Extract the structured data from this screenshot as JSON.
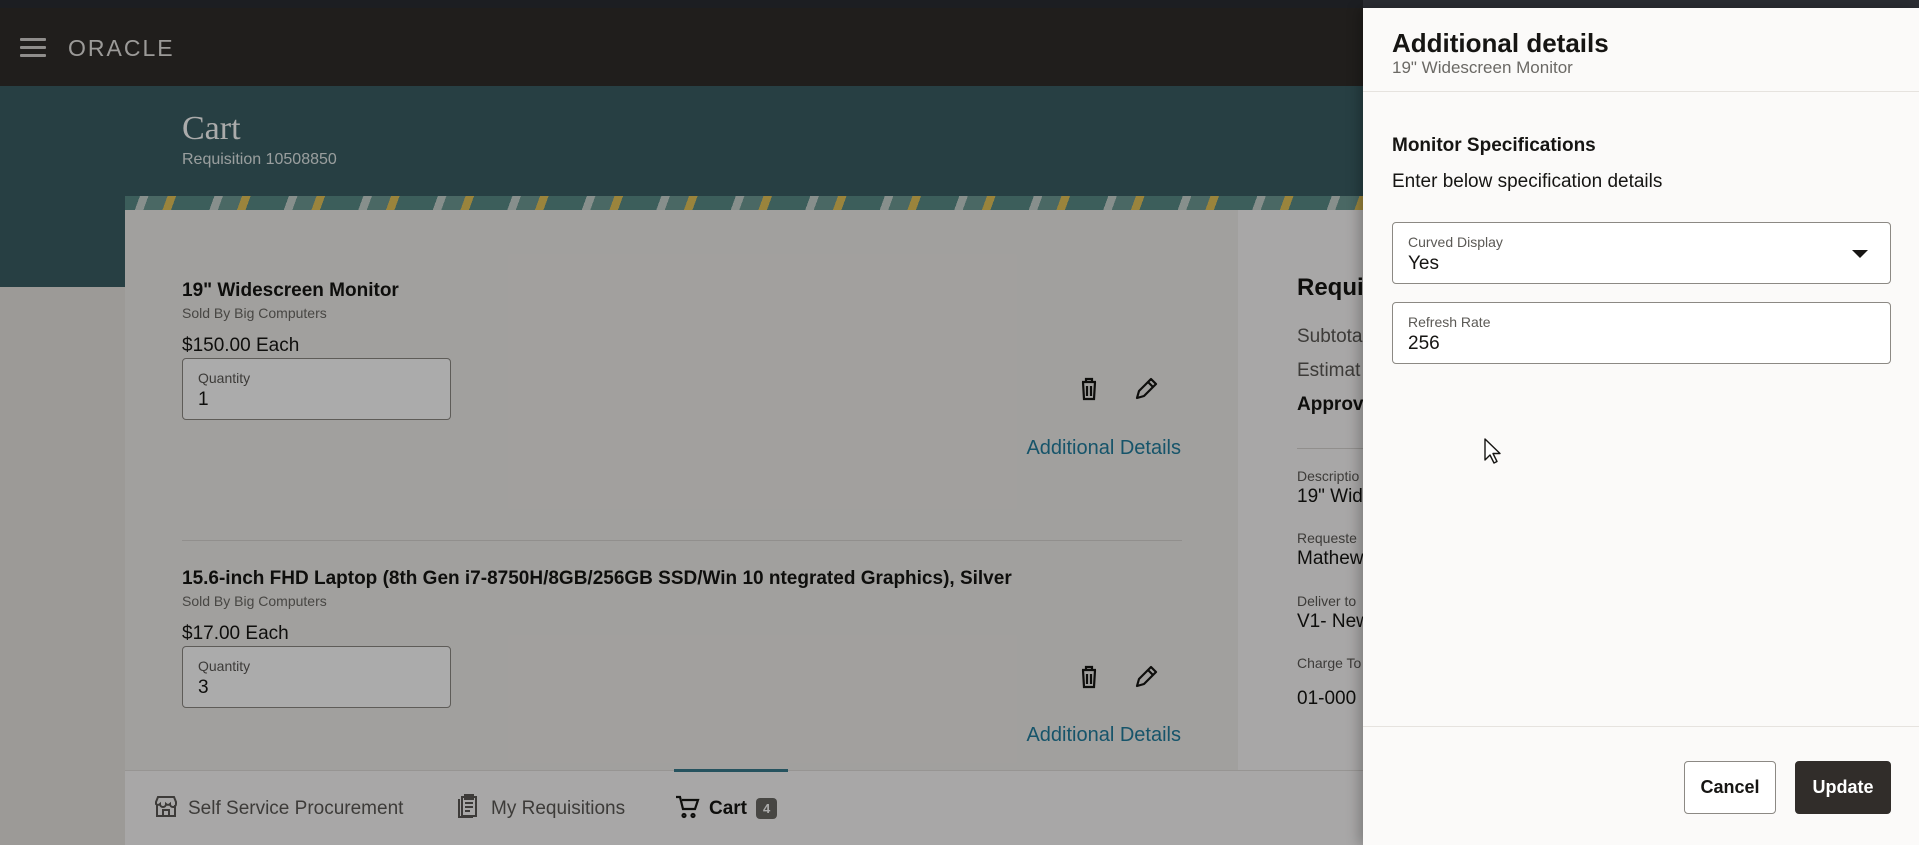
{
  "header": {
    "logo": "ORACLE"
  },
  "banner": {
    "title": "Cart",
    "subtitle": "Requisition 10508850"
  },
  "cart": {
    "items": [
      {
        "title": "19\" Widescreen Monitor",
        "seller": "Sold By Big Computers",
        "price": "$150.00 Each",
        "quantity_label": "Quantity",
        "quantity": "1",
        "details_link": "Additional Details"
      },
      {
        "title": "15.6-inch FHD Laptop (8th Gen i7-8750H/8GB/256GB SSD/Win 10 ntegrated Graphics), Silver",
        "seller": "Sold By Big Computers",
        "price": "$17.00 Each",
        "quantity_label": "Quantity",
        "quantity": "3",
        "details_link": "Additional Details"
      }
    ]
  },
  "summary": {
    "title": "Requi",
    "subtotal": "Subtota",
    "estimated": "Estimat",
    "approval": "Approv",
    "description_label": "Descriptio",
    "description": "19\" Wid",
    "requester_label": "Requeste",
    "requester": "Mathew",
    "deliver_label": "Deliver to",
    "deliver": "V1- New",
    "charge_label": "Charge To",
    "charge": "01-000"
  },
  "bottom_nav": {
    "items": [
      {
        "label": "Self Service Procurement"
      },
      {
        "label": "My Requisitions"
      },
      {
        "label": "Cart",
        "badge": "4"
      }
    ]
  },
  "drawer": {
    "title": "Additional details",
    "subtitle": "19\" Widescreen Monitor",
    "section_title": "Monitor Specifications",
    "section_subtitle": "Enter below specification details",
    "fields": [
      {
        "label": "Curved Display",
        "value": "Yes"
      },
      {
        "label": "Refresh Rate",
        "value": "256"
      }
    ],
    "cancel_label": "Cancel",
    "update_label": "Update"
  },
  "icons": {
    "menu": "hamburger-icon",
    "delete": "trash-icon",
    "edit": "pencil-icon",
    "store": "store-icon",
    "requisitions": "clipboard-icon",
    "cart": "cart-icon"
  },
  "colors": {
    "header": "#312d2a",
    "banner": "#3b5f64",
    "link": "#227e9e",
    "primary_button": "#312d2a"
  }
}
